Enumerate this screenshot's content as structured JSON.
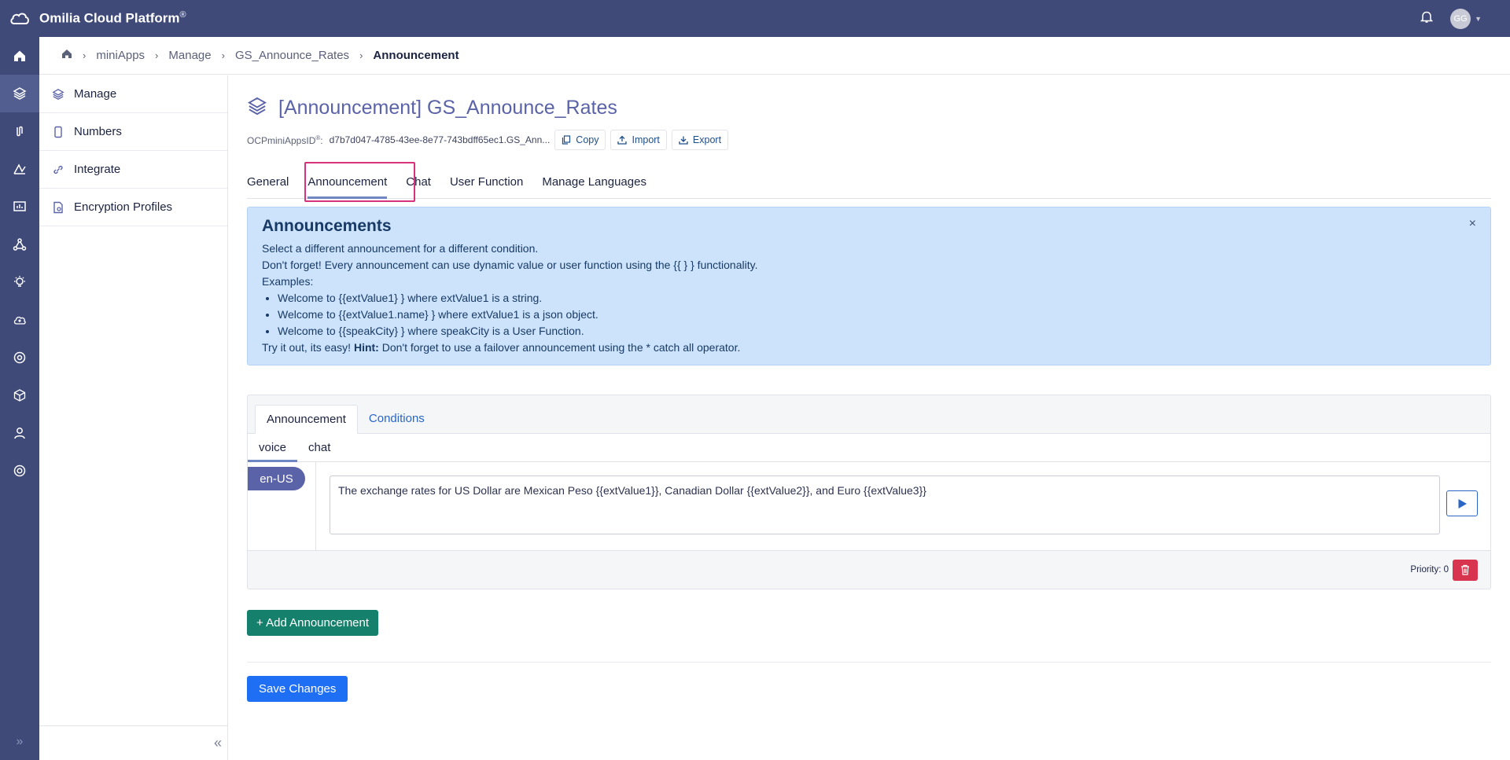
{
  "app": {
    "brand": "Omilia Cloud Platform",
    "brand_mark": "®",
    "avatar_initials": "GG"
  },
  "breadcrumb": {
    "items": [
      "miniApps",
      "Manage",
      "GS_Announce_Rates"
    ],
    "current": "Announcement"
  },
  "sidebar": {
    "items": [
      {
        "label": "Manage",
        "icon": "layers-icon"
      },
      {
        "label": "Numbers",
        "icon": "phone-icon"
      },
      {
        "label": "Integrate",
        "icon": "link-icon"
      },
      {
        "label": "Encryption Profiles",
        "icon": "doc-lock-icon"
      }
    ]
  },
  "page": {
    "title": "[Announcement] GS_Announce_Rates",
    "id_label": "OCPminiAppsID",
    "id_mark": "®",
    "id_suffix": ":",
    "id_value": "d7b7d047-4785-43ee-8e77-743bdff65ec1.GS_Ann...",
    "copy_label": "Copy",
    "import_label": "Import",
    "export_label": "Export"
  },
  "tabs": [
    "General",
    "Announcement",
    "Chat",
    "User Function",
    "Manage Languages"
  ],
  "info": {
    "title": "Announcements",
    "line1": "Select a different announcement for a different condition.",
    "line2": "Don't forget! Every announcement can use dynamic value or user function using the {{ } } functionality.",
    "line3": "Examples:",
    "examples": [
      "Welcome to {{extValue1} } where extValue1 is a string.",
      "Welcome to {{extValue1.name} } where extValue1 is a json object.",
      "Welcome to {{speakCity} } where speakCity is a User Function."
    ],
    "hint_prefix": "Try it out, its easy! ",
    "hint_bold": "Hint:",
    "hint_text": " Don't forget to use a failover announcement using the * catch all operator.",
    "close_label": "×"
  },
  "panel": {
    "tabs": [
      "Announcement",
      "Conditions"
    ],
    "subtabs": [
      "voice",
      "chat"
    ],
    "language": "en-US",
    "announcement_text": "The exchange rates for US Dollar are Mexican Peso {{extValue1}}, Canadian Dollar {{extValue2}}, and Euro {{extValue3}}",
    "priority_label": "Priority: 0"
  },
  "actions": {
    "add_label": "+ Add Announcement",
    "save_label": "Save Changes"
  },
  "colors": {
    "topbar": "#3f4a78",
    "title": "#5b63a8",
    "highlight": "#d8327a",
    "add_button": "#15806b",
    "save_button": "#1f6ff5",
    "delete_button": "#d9344f"
  }
}
